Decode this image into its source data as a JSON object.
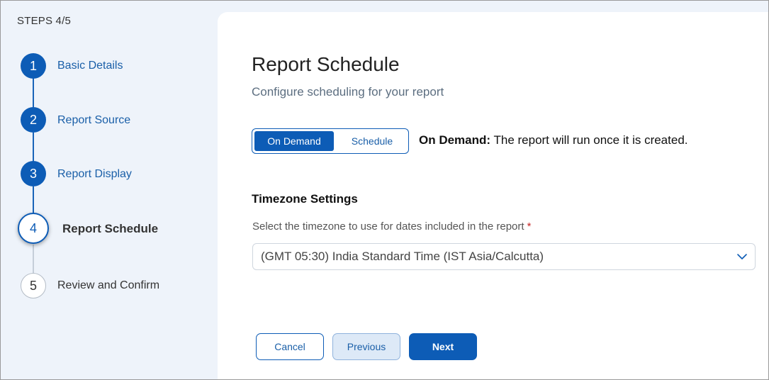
{
  "sidebar": {
    "steps_counter": "STEPS 4/5",
    "steps": [
      {
        "number": "1",
        "label": "Basic Details",
        "status": "completed"
      },
      {
        "number": "2",
        "label": "Report Source",
        "status": "completed"
      },
      {
        "number": "3",
        "label": "Report Display",
        "status": "completed"
      },
      {
        "number": "4",
        "label": "Report Schedule",
        "status": "current"
      },
      {
        "number": "5",
        "label": "Review and Confirm",
        "status": "pending"
      }
    ]
  },
  "main": {
    "title": "Report Schedule",
    "subtitle": "Configure scheduling for your report",
    "mode_toggle": {
      "options": [
        "On Demand",
        "Schedule"
      ],
      "selected": "On Demand"
    },
    "mode_description": {
      "label": "On Demand:",
      "text": "The report will run once it is created."
    },
    "timezone": {
      "section_title": "Timezone Settings",
      "field_label": "Select the timezone to use for dates included in the report",
      "required_marker": "*",
      "selected_value": "(GMT 05:30) India Standard Time (IST Asia/Calcutta)"
    },
    "buttons": {
      "cancel": "Cancel",
      "previous": "Previous",
      "next": "Next"
    }
  },
  "colors": {
    "primary": "#0d5cb6",
    "sidebar_bg": "#eef3fa",
    "required": "#c62828"
  },
  "icons": {
    "select_chevron": "chevron-down-icon"
  }
}
